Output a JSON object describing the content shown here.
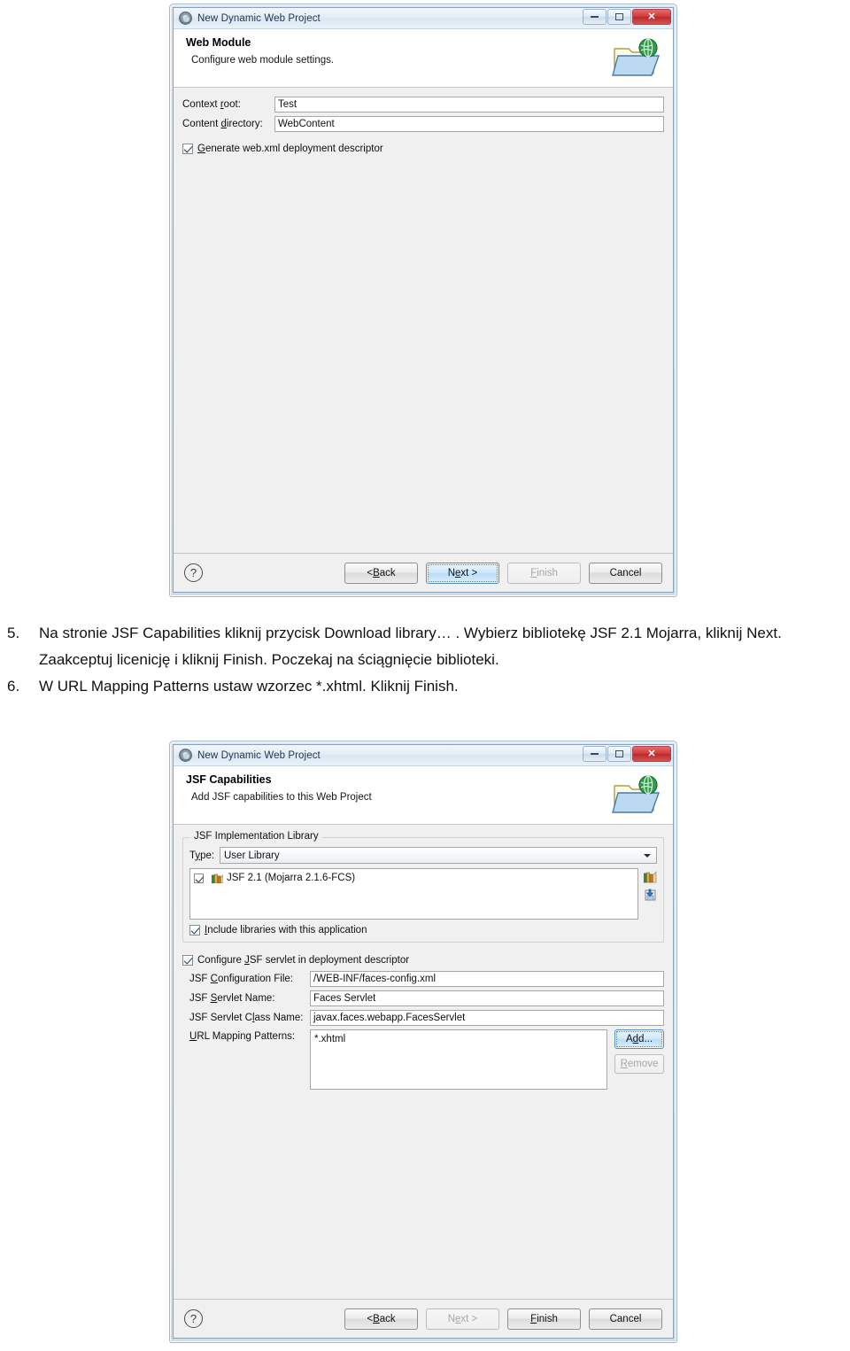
{
  "dialog1": {
    "window_title": "New Dynamic Web Project",
    "title_icon": "eclipse-gear-icon",
    "wizard_icon": "folder-globe-icon",
    "page_title": "Web Module",
    "page_subtitle": "Configure web module settings.",
    "fields": [
      {
        "label_pre": "Context ",
        "label_mn": "r",
        "label_post": "oot:",
        "value": "Test"
      },
      {
        "label_pre": "Content ",
        "label_mn": "d",
        "label_post": "irectory:",
        "value": "WebContent"
      }
    ],
    "checkbox": {
      "label_pre": "",
      "label_mn": "G",
      "label_post": "enerate web.xml deployment descriptor",
      "checked": true
    },
    "help_glyph": "?",
    "buttons": [
      {
        "label_pre": "< ",
        "label_mn": "B",
        "label_post": "ack",
        "state": "normal"
      },
      {
        "label_pre": "N",
        "label_mn": "e",
        "label_post": "xt >",
        "state": "focused"
      },
      {
        "label_pre": "",
        "label_mn": "F",
        "label_post": "inish",
        "state": "disabled"
      },
      {
        "label_pre": "Cancel",
        "label_mn": "",
        "label_post": "",
        "state": "normal"
      }
    ]
  },
  "steps": [
    {
      "number": "5.",
      "text": "Na stronie JSF Capabilities kliknij przycisk Download library… . Wybierz bibliotekę JSF 2.1 Mojarra, kliknij Next. Zaakceptuj licenicję i kliknij Finish. Poczekaj na ściągnięcie biblioteki."
    },
    {
      "number": "6.",
      "text": "W URL Mapping Patterns ustaw wzorzec *.xhtml. Kliknij Finish."
    }
  ],
  "dialog2": {
    "window_title": "New Dynamic Web Project",
    "title_icon": "eclipse-gear-icon",
    "wizard_icon": "folder-globe-icon",
    "page_title": "JSF Capabilities",
    "page_subtitle": "Add JSF capabilities to this Web Project",
    "library_group": {
      "title": "JSF Implementation Library",
      "type_label_pre": "T",
      "type_label_mn": "y",
      "type_label_post": "pe:",
      "type_value": "User Library",
      "library_item": {
        "label": "JSF 2.1 (Mojarra 2.1.6-FCS)",
        "checked": true,
        "icon": "books-icon"
      },
      "side_icons": [
        "manage-libraries-icon",
        "download-library-icon"
      ],
      "include_checkbox": {
        "label_pre": "",
        "label_mn": "I",
        "label_post": "nclude libraries with this application",
        "checked": true
      }
    },
    "servlet_checkbox": {
      "label_pre": "Configure ",
      "label_mn": "J",
      "label_post": "SF servlet in deployment descriptor",
      "checked": true
    },
    "fields": [
      {
        "label_pre": "JSF ",
        "label_mn": "C",
        "label_post": "onfiguration File:",
        "value": "/WEB-INF/faces-config.xml"
      },
      {
        "label_pre": "JSF ",
        "label_mn": "S",
        "label_post": "ervlet Name:",
        "value": "Faces Servlet"
      },
      {
        "label_pre": "JSF Servlet C",
        "label_mn": "l",
        "label_post": "ass Name:",
        "value": "javax.faces.webapp.FacesServlet"
      }
    ],
    "url_patterns": {
      "label_pre": "",
      "label_mn": "U",
      "label_post": "RL Mapping Patterns:",
      "items": [
        "*.xhtml"
      ],
      "add_button": {
        "label_pre": "A",
        "label_mn": "d",
        "label_post": "d...",
        "state": "focused"
      },
      "remove_button": {
        "label_pre": "",
        "label_mn": "R",
        "label_post": "emove",
        "state": "disabled"
      }
    },
    "help_glyph": "?",
    "buttons": [
      {
        "label_pre": "< ",
        "label_mn": "B",
        "label_post": "ack",
        "state": "normal"
      },
      {
        "label_pre": "N",
        "label_mn": "e",
        "label_post": "xt >",
        "state": "disabled"
      },
      {
        "label_pre": "",
        "label_mn": "F",
        "label_post": "inish",
        "state": "normal"
      },
      {
        "label_pre": "Cancel",
        "label_mn": "",
        "label_post": "",
        "state": "normal"
      }
    ]
  }
}
